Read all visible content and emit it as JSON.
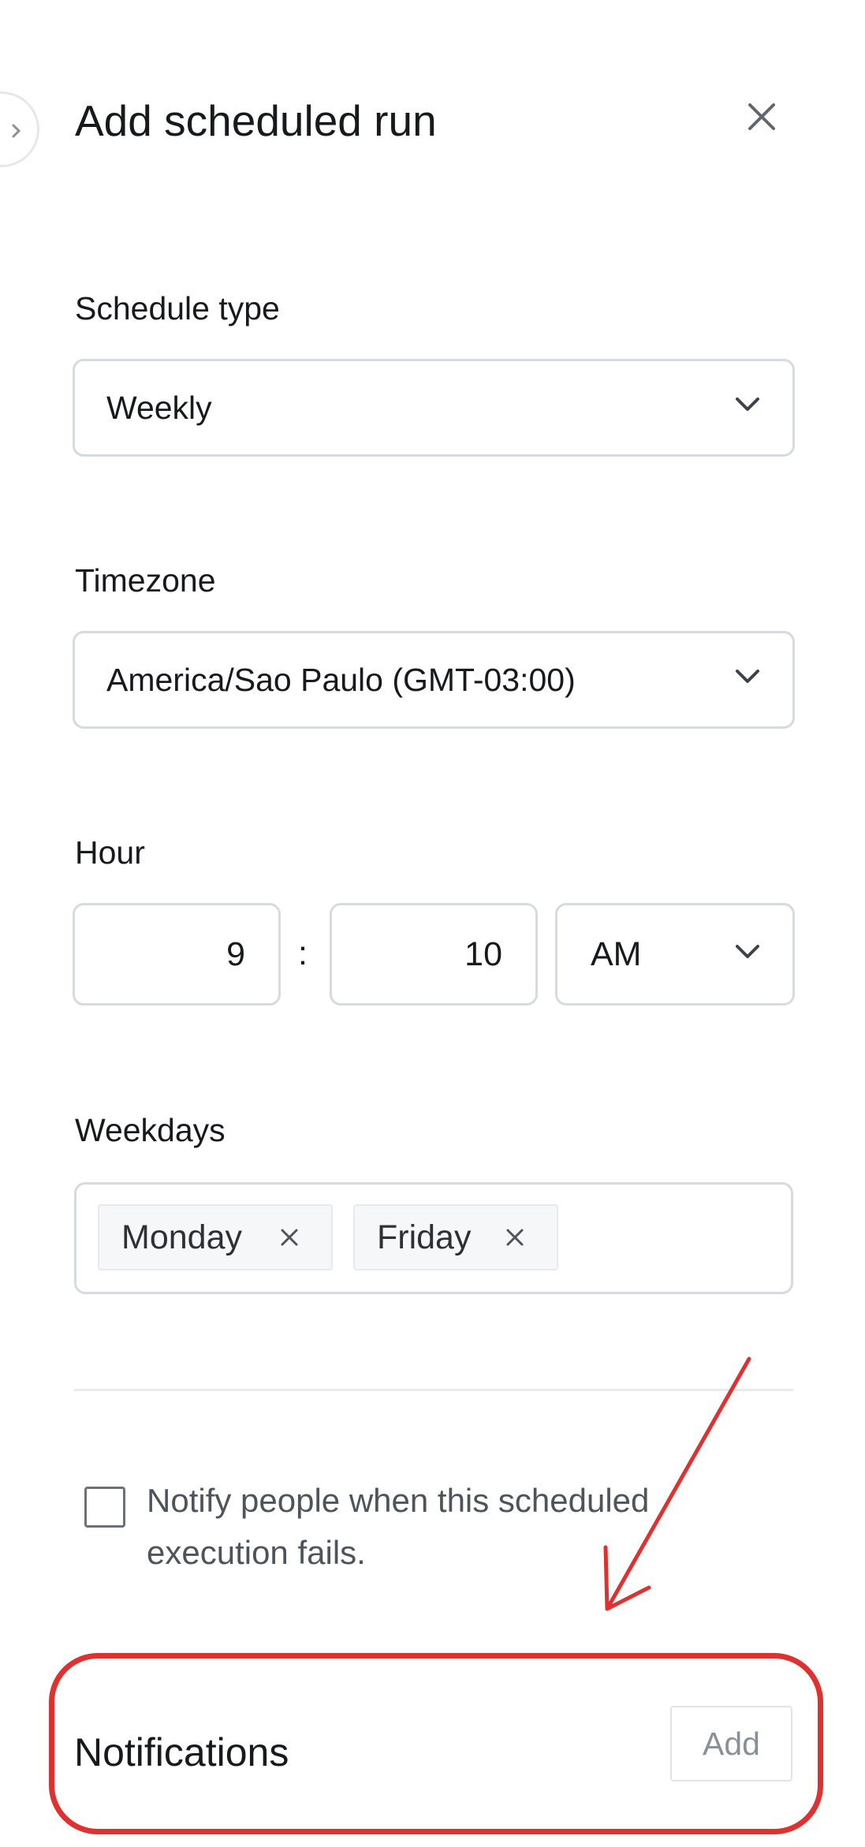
{
  "header": {
    "title": "Add scheduled run",
    "close_icon": "close-icon"
  },
  "schedule_type": {
    "label": "Schedule type",
    "value": "Weekly"
  },
  "timezone": {
    "label": "Timezone",
    "value": "America/Sao Paulo (GMT-03:00)"
  },
  "hour": {
    "label": "Hour",
    "hour_value": "9",
    "separator": ":",
    "minute_value": "10",
    "period_value": "AM"
  },
  "weekdays": {
    "label": "Weekdays",
    "chips": [
      {
        "label": "Monday"
      },
      {
        "label": "Friday"
      }
    ]
  },
  "notify": {
    "checked": false,
    "text": "Notify people when this scheduled execution fails."
  },
  "notifications": {
    "label": "Notifications",
    "add_label": "Add"
  },
  "colors": {
    "annotation": "#e03131",
    "border": "#d6dbe0",
    "text": "#17191c"
  }
}
